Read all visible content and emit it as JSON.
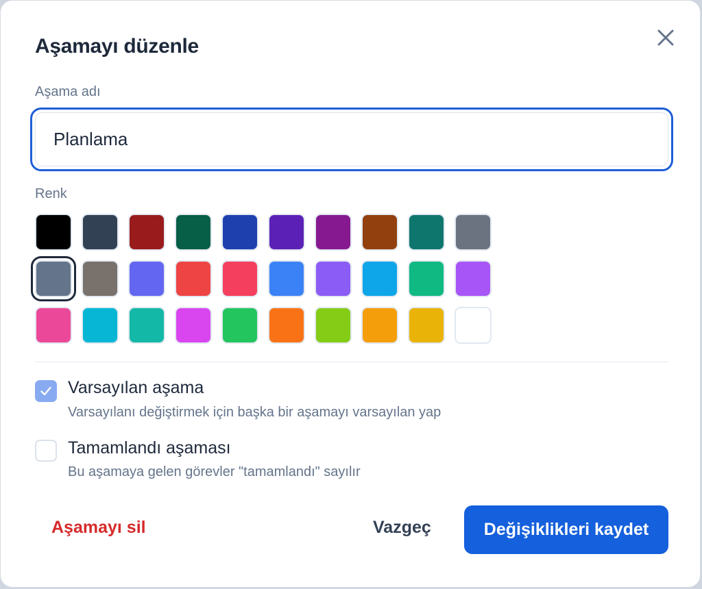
{
  "dialog": {
    "title": "Aşamayı düzenle"
  },
  "name_field": {
    "label": "Aşama adı",
    "value": "Planlama"
  },
  "color_field": {
    "label": "Renk",
    "selected_index": 10,
    "swatches": [
      "#000000",
      "#334155",
      "#991b1b",
      "#065f46",
      "#1e40af",
      "#5b21b6",
      "#86198f",
      "#92400e",
      "#0f766e",
      "#6b7280",
      "#64748b",
      "#78716c",
      "#6366f1",
      "#ef4444",
      "#f43f5e",
      "#3b82f6",
      "#8b5cf6",
      "#0ea5e9",
      "#10b981",
      "#a855f7",
      "#ec4899",
      "#06b6d4",
      "#14b8a6",
      "#d946ef",
      "#22c55e",
      "#f97316",
      "#84cc16",
      "#f59e0b",
      "#eab308",
      "#ffffff"
    ]
  },
  "options": {
    "default_stage": {
      "checked": true,
      "title": "Varsayılan aşama",
      "description": "Varsayılanı değiştirmek için başka bir aşamayı varsayılan yap"
    },
    "done_stage": {
      "checked": false,
      "title": "Tamamlandı aşaması",
      "description": "Bu aşamaya gelen görevler \"tamamlandı\" sayılır"
    }
  },
  "footer": {
    "delete_label": "Aşamayı sil",
    "cancel_label": "Vazgeç",
    "save_label": "Değişiklikleri kaydet"
  },
  "icons": {
    "close": "close-icon",
    "check": "check-icon"
  }
}
